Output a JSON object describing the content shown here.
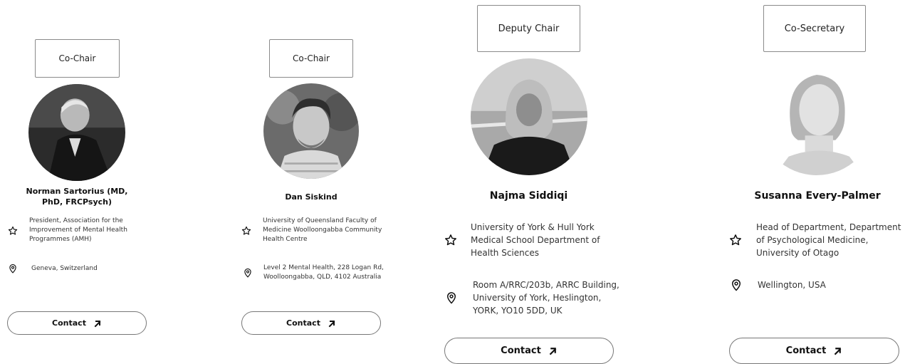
{
  "contact_label": "Contact",
  "cards": [
    {
      "role": "Co-Chair",
      "name": "Norman Sartorius (MD, PhD, FRCPsych)",
      "affiliation": "President, Association for the Improvement of Mental Health Programmes (AMH)",
      "location": "Geneva, Switzerland"
    },
    {
      "role": "Co-Chair",
      "name": "Dan Siskind",
      "affiliation": "University of Queensland Faculty of Medicine Woolloongabba Community Health Centre",
      "location": "Level 2 Mental Health, 228 Logan Rd, Woolloongabba, QLD, 4102 Australia"
    },
    {
      "role": "Deputy Chair",
      "name": "Najma Siddiqi",
      "affiliation": "University of York & Hull York Medical School Department of Health Sciences",
      "location": "Room A/RRC/203b, ARRC Building, University of York, Heslington, YORK, YO10 5DD, UK"
    },
    {
      "role": "Co-Secretary",
      "name": "Susanna Every-Palmer",
      "affiliation": "Head of Department, Department of Psychological Medicine, University of Otago",
      "location": "Wellington, USA"
    }
  ]
}
